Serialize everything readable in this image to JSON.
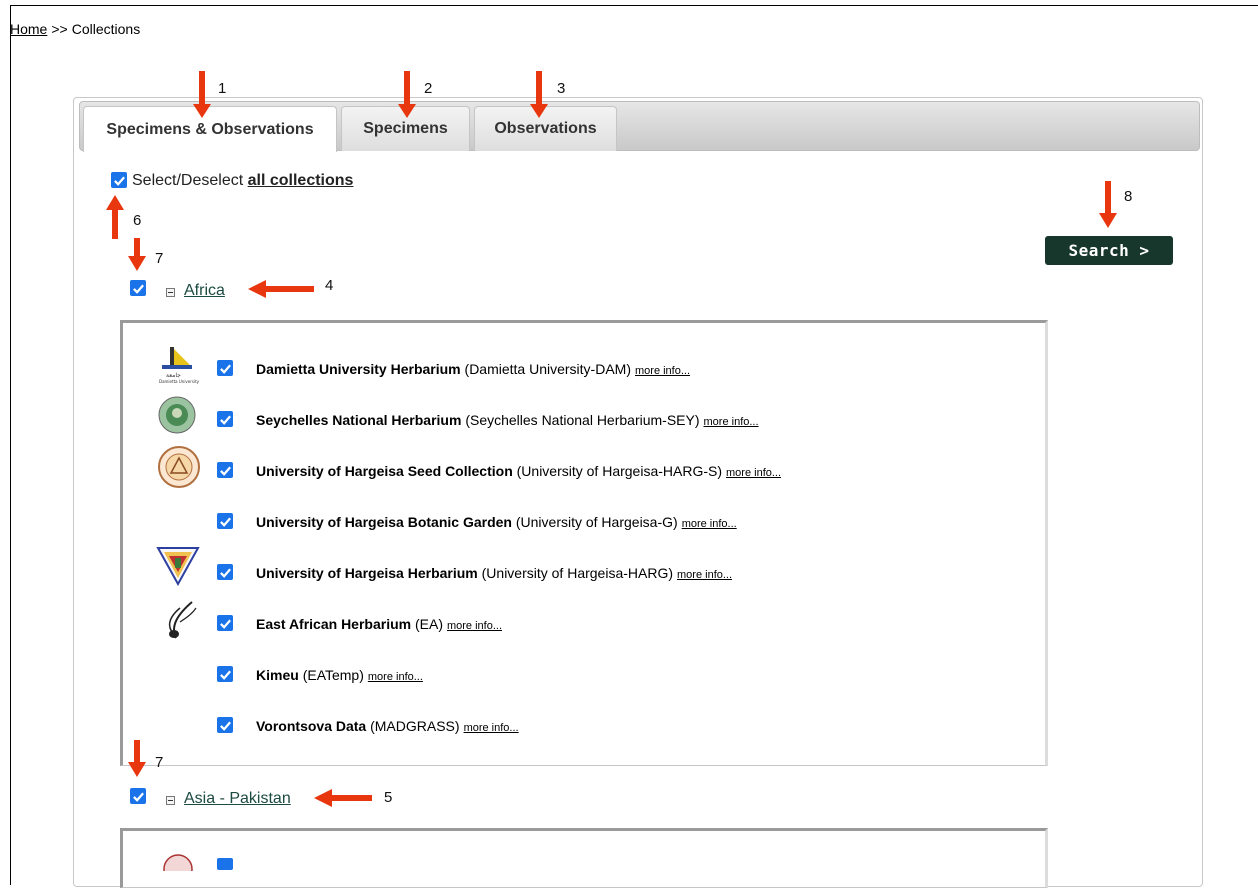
{
  "breadcrumb": {
    "home": "Home",
    "separator": ">>",
    "current": "Collections"
  },
  "tabs": [
    {
      "label": "Specimens & Observations",
      "active": true
    },
    {
      "label": "Specimens",
      "active": false
    },
    {
      "label": "Observations",
      "active": false
    }
  ],
  "select_all": {
    "prefix": "Select/Deselect",
    "link": "all collections",
    "checked": true
  },
  "search_button": "Search >",
  "regions": [
    {
      "name": "Africa",
      "checked": true,
      "collections": [
        {
          "name": "Damietta University Herbarium",
          "code": "(Damietta University-DAM)",
          "more": "more info...",
          "logo": "damietta-logo"
        },
        {
          "name": "Seychelles National Herbarium",
          "code": "(Seychelles National Herbarium-SEY)",
          "more": "more info...",
          "logo": "seychelles-logo"
        },
        {
          "name": "University of Hargeisa Seed Collection",
          "code": "(University of Hargeisa-HARG-S)",
          "more": "more info...",
          "logo": "hargeisa-seal-logo"
        },
        {
          "name": "University of Hargeisa Botanic Garden",
          "code": "(University of Hargeisa-G)",
          "more": "more info...",
          "logo": ""
        },
        {
          "name": "University of Hargeisa Herbarium",
          "code": "(University of Hargeisa-HARG)",
          "more": "more info...",
          "logo": "hargeisa-shield-logo"
        },
        {
          "name": "East African Herbarium",
          "code": "(EA)",
          "more": "more info...",
          "logo": "plant-logo"
        },
        {
          "name": "Kimeu",
          "code": "(EATemp)",
          "more": "more info...",
          "logo": ""
        },
        {
          "name": "Vorontsova Data",
          "code": "(MADGRASS)",
          "more": "more info...",
          "logo": ""
        }
      ]
    },
    {
      "name": "Asia - Pakistan",
      "checked": true,
      "collections": []
    }
  ],
  "annotations": [
    "1",
    "2",
    "3",
    "4",
    "5",
    "6",
    "7",
    "7",
    "8"
  ],
  "colors": {
    "arrow": "#e8360e",
    "checkbox": "#1a73e8",
    "search_bg": "#17372c",
    "link": "#1b4a40"
  }
}
